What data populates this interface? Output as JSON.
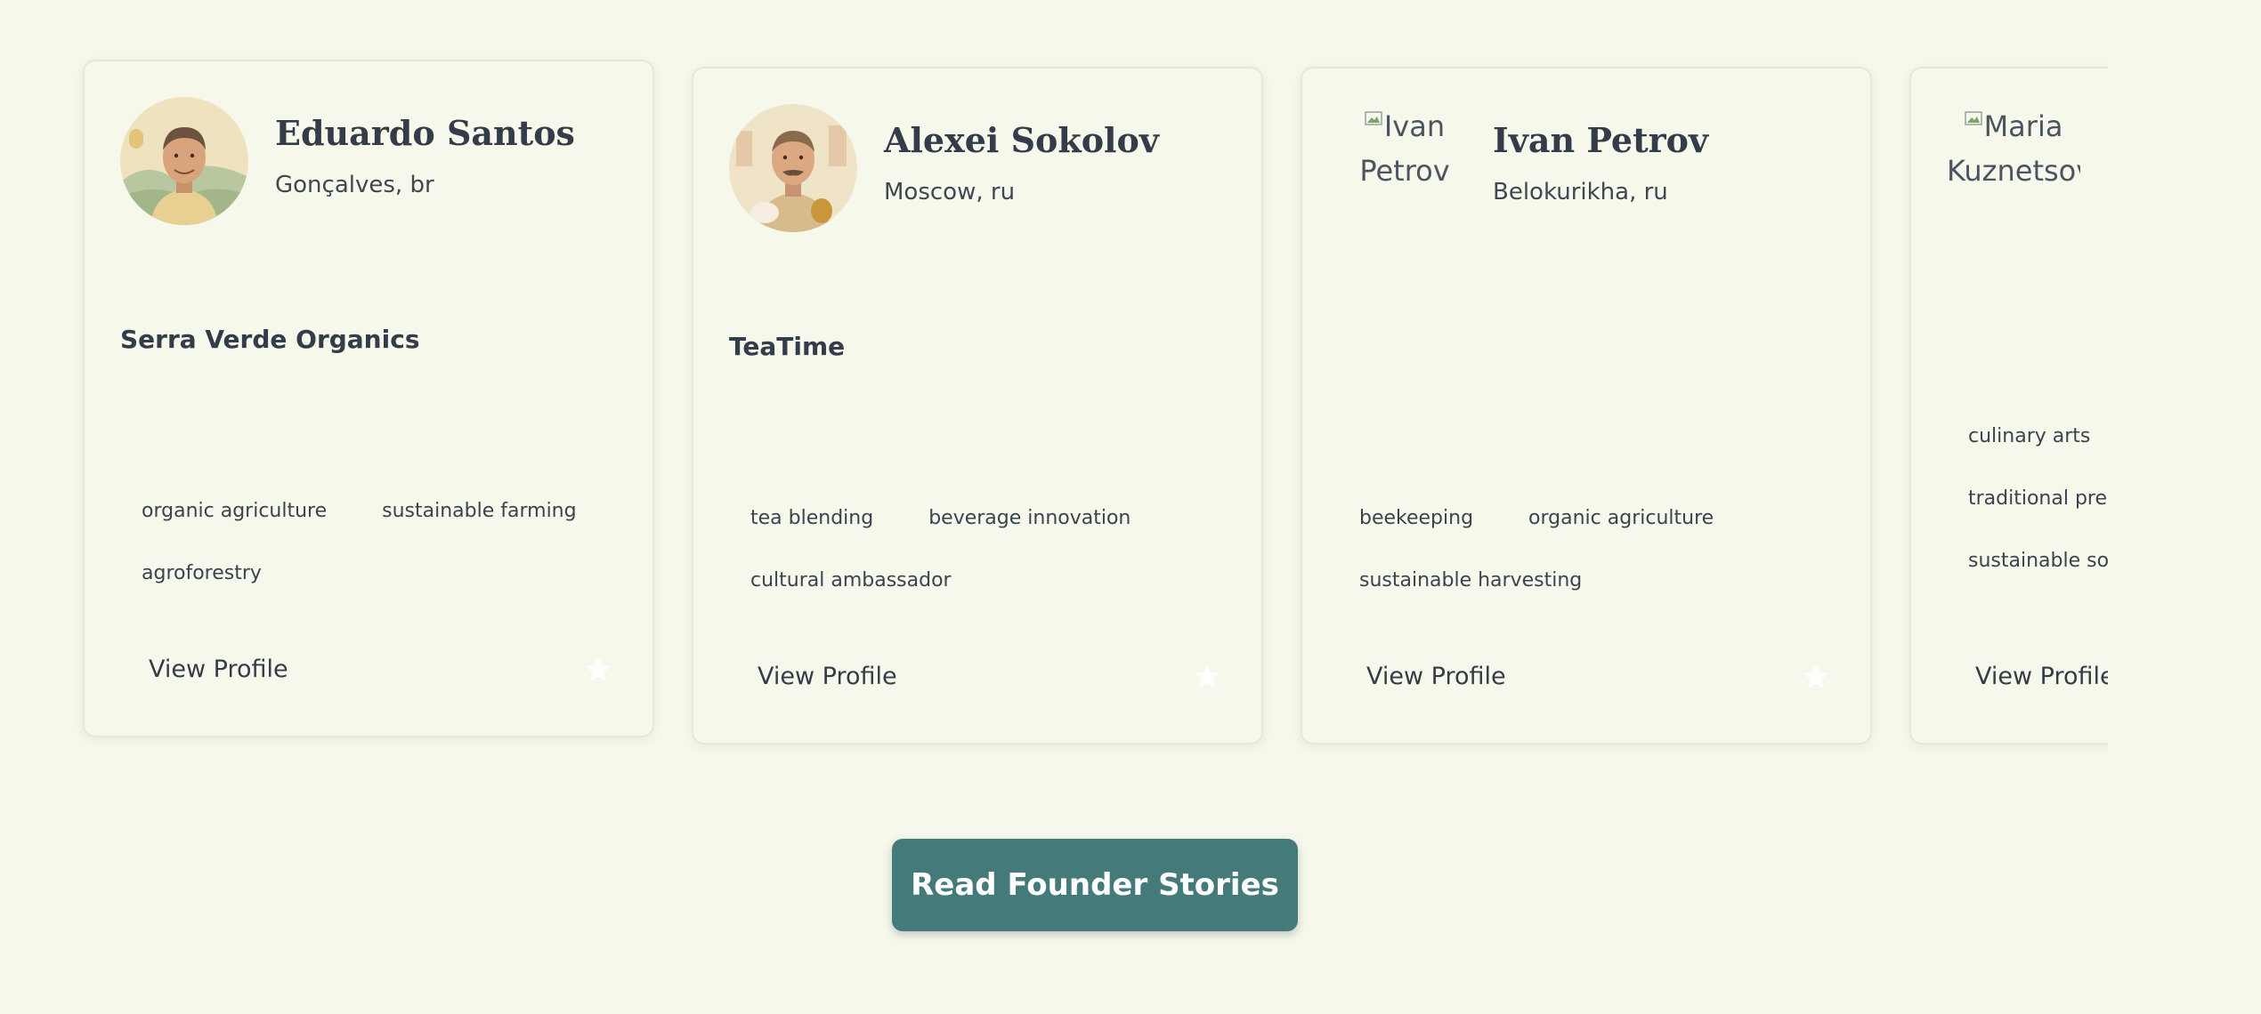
{
  "founders": [
    {
      "name": "Eduardo Santos",
      "location": "Gonçalves, br",
      "company": "Serra Verde Organics",
      "avatar": "portrait-illustration",
      "tags": [
        "organic agriculture",
        "sustainable farming",
        "agroforestry"
      ],
      "view_profile_label": "View Profile",
      "favorite_icon": "star-icon"
    },
    {
      "name": "Alexei Sokolov",
      "location": "Moscow, ru",
      "company": "TeaTime",
      "avatar": "portrait-illustration",
      "tags": [
        "tea blending",
        "beverage innovation",
        "cultural ambassador"
      ],
      "view_profile_label": "View Profile",
      "favorite_icon": "star-icon"
    },
    {
      "name": "Ivan Petrov",
      "location": "Belokurikha, ru",
      "company": "",
      "avatar_alt": "Ivan Petrov",
      "tags": [
        "beekeeping",
        "organic agriculture",
        "sustainable harvesting"
      ],
      "view_profile_label": "View Profile",
      "favorite_icon": "star-icon"
    },
    {
      "avatar_alt": "Maria Kuznetsova",
      "tags": [
        "culinary arts",
        "traditional pres",
        "sustainable sou"
      ],
      "view_profile_label": "View Profile"
    }
  ],
  "cta": {
    "label": "Read Founder Stories"
  },
  "colors": {
    "page_background": "#f7f8ec",
    "card_border": "#e6e8da",
    "text_primary": "#333c48",
    "cta_background": "#457a7b",
    "cta_text": "#ffffff",
    "star": "#ffffff"
  }
}
